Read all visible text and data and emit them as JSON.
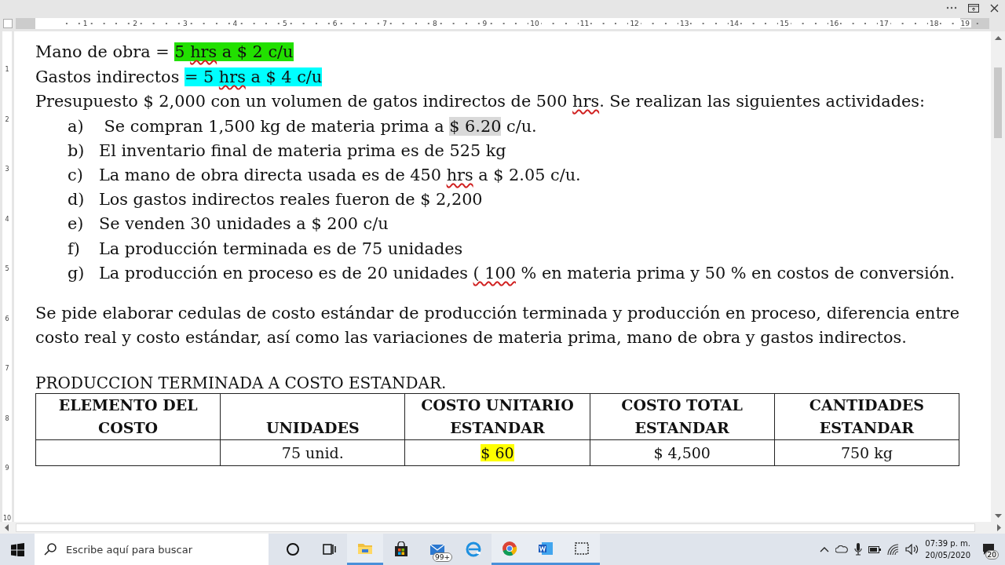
{
  "ruler": {
    "numbers": [
      "1",
      "2",
      "3",
      "4",
      "5",
      "6",
      "7",
      "8",
      "9",
      "10",
      "11",
      "12",
      "13",
      "14",
      "15",
      "16",
      "17",
      "18",
      "19"
    ]
  },
  "vertical_ruler": {
    "numbers": [
      "1",
      "2",
      "3",
      "4",
      "5",
      "6",
      "7",
      "8",
      "9",
      "10"
    ]
  },
  "document": {
    "lines": [
      [
        {
          "text": "Mano de obra = "
        },
        {
          "text": "5 ",
          "color": "#22e000"
        },
        {
          "text": "hrs",
          "color": "#22e000",
          "misspelled": true
        },
        {
          "text": " a $ 2 c/u",
          "color": "#22e000"
        }
      ],
      [
        {
          "text": "Gastos indirectos "
        },
        {
          "text": "= 5 ",
          "color": "#00ffff"
        },
        {
          "text": "hrs",
          "color": "#00ffff",
          "misspelled": true
        },
        {
          "text": " a $ 4 c/u",
          "color": "#00ffff"
        }
      ],
      [
        {
          "text": "Presupuesto $ 2,000 con un volumen de gatos indirectos de 500 "
        },
        {
          "text": "hrs",
          "misspelled": true
        },
        {
          "text": ". Se realizan las siguientes actividades:"
        }
      ]
    ],
    "activities": [
      {
        "marker": "a)",
        "runs": [
          {
            "text": " Se compran 1,500 kg de materia prima a "
          },
          {
            "text": "$ 6.20",
            "color": "#d9d9d9"
          },
          {
            "text": " c/u."
          }
        ]
      },
      {
        "marker": "b)",
        "runs": [
          {
            "text": "El inventario final de materia prima es de 525 kg"
          }
        ]
      },
      {
        "marker": "c)",
        "runs": [
          {
            "text": "La mano de obra directa usada es de 450 "
          },
          {
            "text": "hrs",
            "misspelled": true
          },
          {
            "text": " a $ 2.05 c/u."
          }
        ]
      },
      {
        "marker": "d)",
        "runs": [
          {
            "text": "Los gastos indirectos reales fueron de $ 2,200"
          }
        ]
      },
      {
        "marker": "e)",
        "runs": [
          {
            "text": "Se venden 30 unidades a $ 200 c/u"
          }
        ]
      },
      {
        "marker": "f)",
        "runs": [
          {
            "text": "La producción terminada es de 75 unidades"
          }
        ]
      },
      {
        "marker": "g)",
        "runs": [
          {
            "text": "La producción en proceso es de 20 unidades "
          },
          {
            "text": "( 100",
            "misspelled": true
          },
          {
            "text": " % en materia prima y 50 % en costos de conversión."
          }
        ]
      }
    ],
    "request": [
      {
        "text": "Se pide elaborar cedulas de costo estándar de producción terminada y producción en proceso, diferencia entre costo real y costo estándar, así como las variaciones de materia prima, mano de obra y gastos indirectos."
      }
    ],
    "heading": "PRODUCCION TERMINADA A COSTO ESTANDAR.",
    "table": {
      "columns": [
        "ELEMENTO DEL COSTO",
        "UNIDADES",
        "COSTO UNITARIO ESTANDAR",
        "COSTO TOTAL ESTANDAR",
        "CANTIDADES ESTANDAR"
      ],
      "rows": [
        [
          {
            "text": ""
          },
          {
            "text": "75 unid."
          },
          {
            "text": "$ 60",
            "color": "#ffff00"
          },
          {
            "text": "$ 4,500"
          },
          {
            "text": "750 kg"
          }
        ]
      ]
    }
  },
  "taskbar": {
    "search": {
      "placeholder": "Escribe aquí para buscar"
    },
    "apps": [
      {
        "kind": "cortana",
        "running": false
      },
      {
        "kind": "taskview",
        "running": false
      },
      {
        "kind": "folder",
        "running": true
      },
      {
        "kind": "store",
        "running": false
      },
      {
        "kind": "mail",
        "running": false,
        "badge": "99+"
      },
      {
        "kind": "edge",
        "running": false
      },
      {
        "kind": "chrome",
        "running": true
      },
      {
        "kind": "word",
        "running": true
      },
      {
        "kind": "snip",
        "running": true
      }
    ],
    "time": "07:39 p. m.",
    "date": "20/05/2020",
    "notifications": "20"
  }
}
